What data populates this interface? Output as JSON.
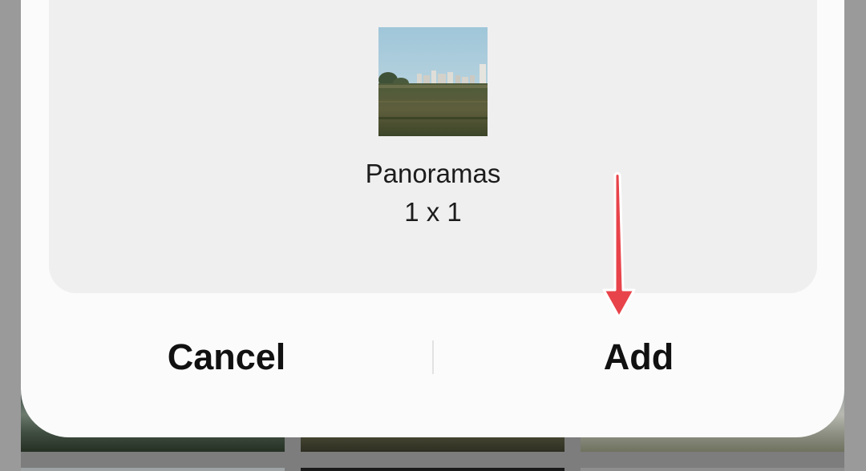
{
  "dialog": {
    "album": {
      "thumbnail": "landscape-photo-thumbnail",
      "name": "Panoramas",
      "size": "1 x 1"
    },
    "buttons": {
      "cancel_label": "Cancel",
      "add_label": "Add"
    }
  },
  "annotation": {
    "arrow_color": "#e8434a",
    "points_to": "add-button"
  },
  "colors": {
    "dialog_background": "#fbfbfb",
    "card_background": "#efeff0",
    "text": "#111111"
  }
}
